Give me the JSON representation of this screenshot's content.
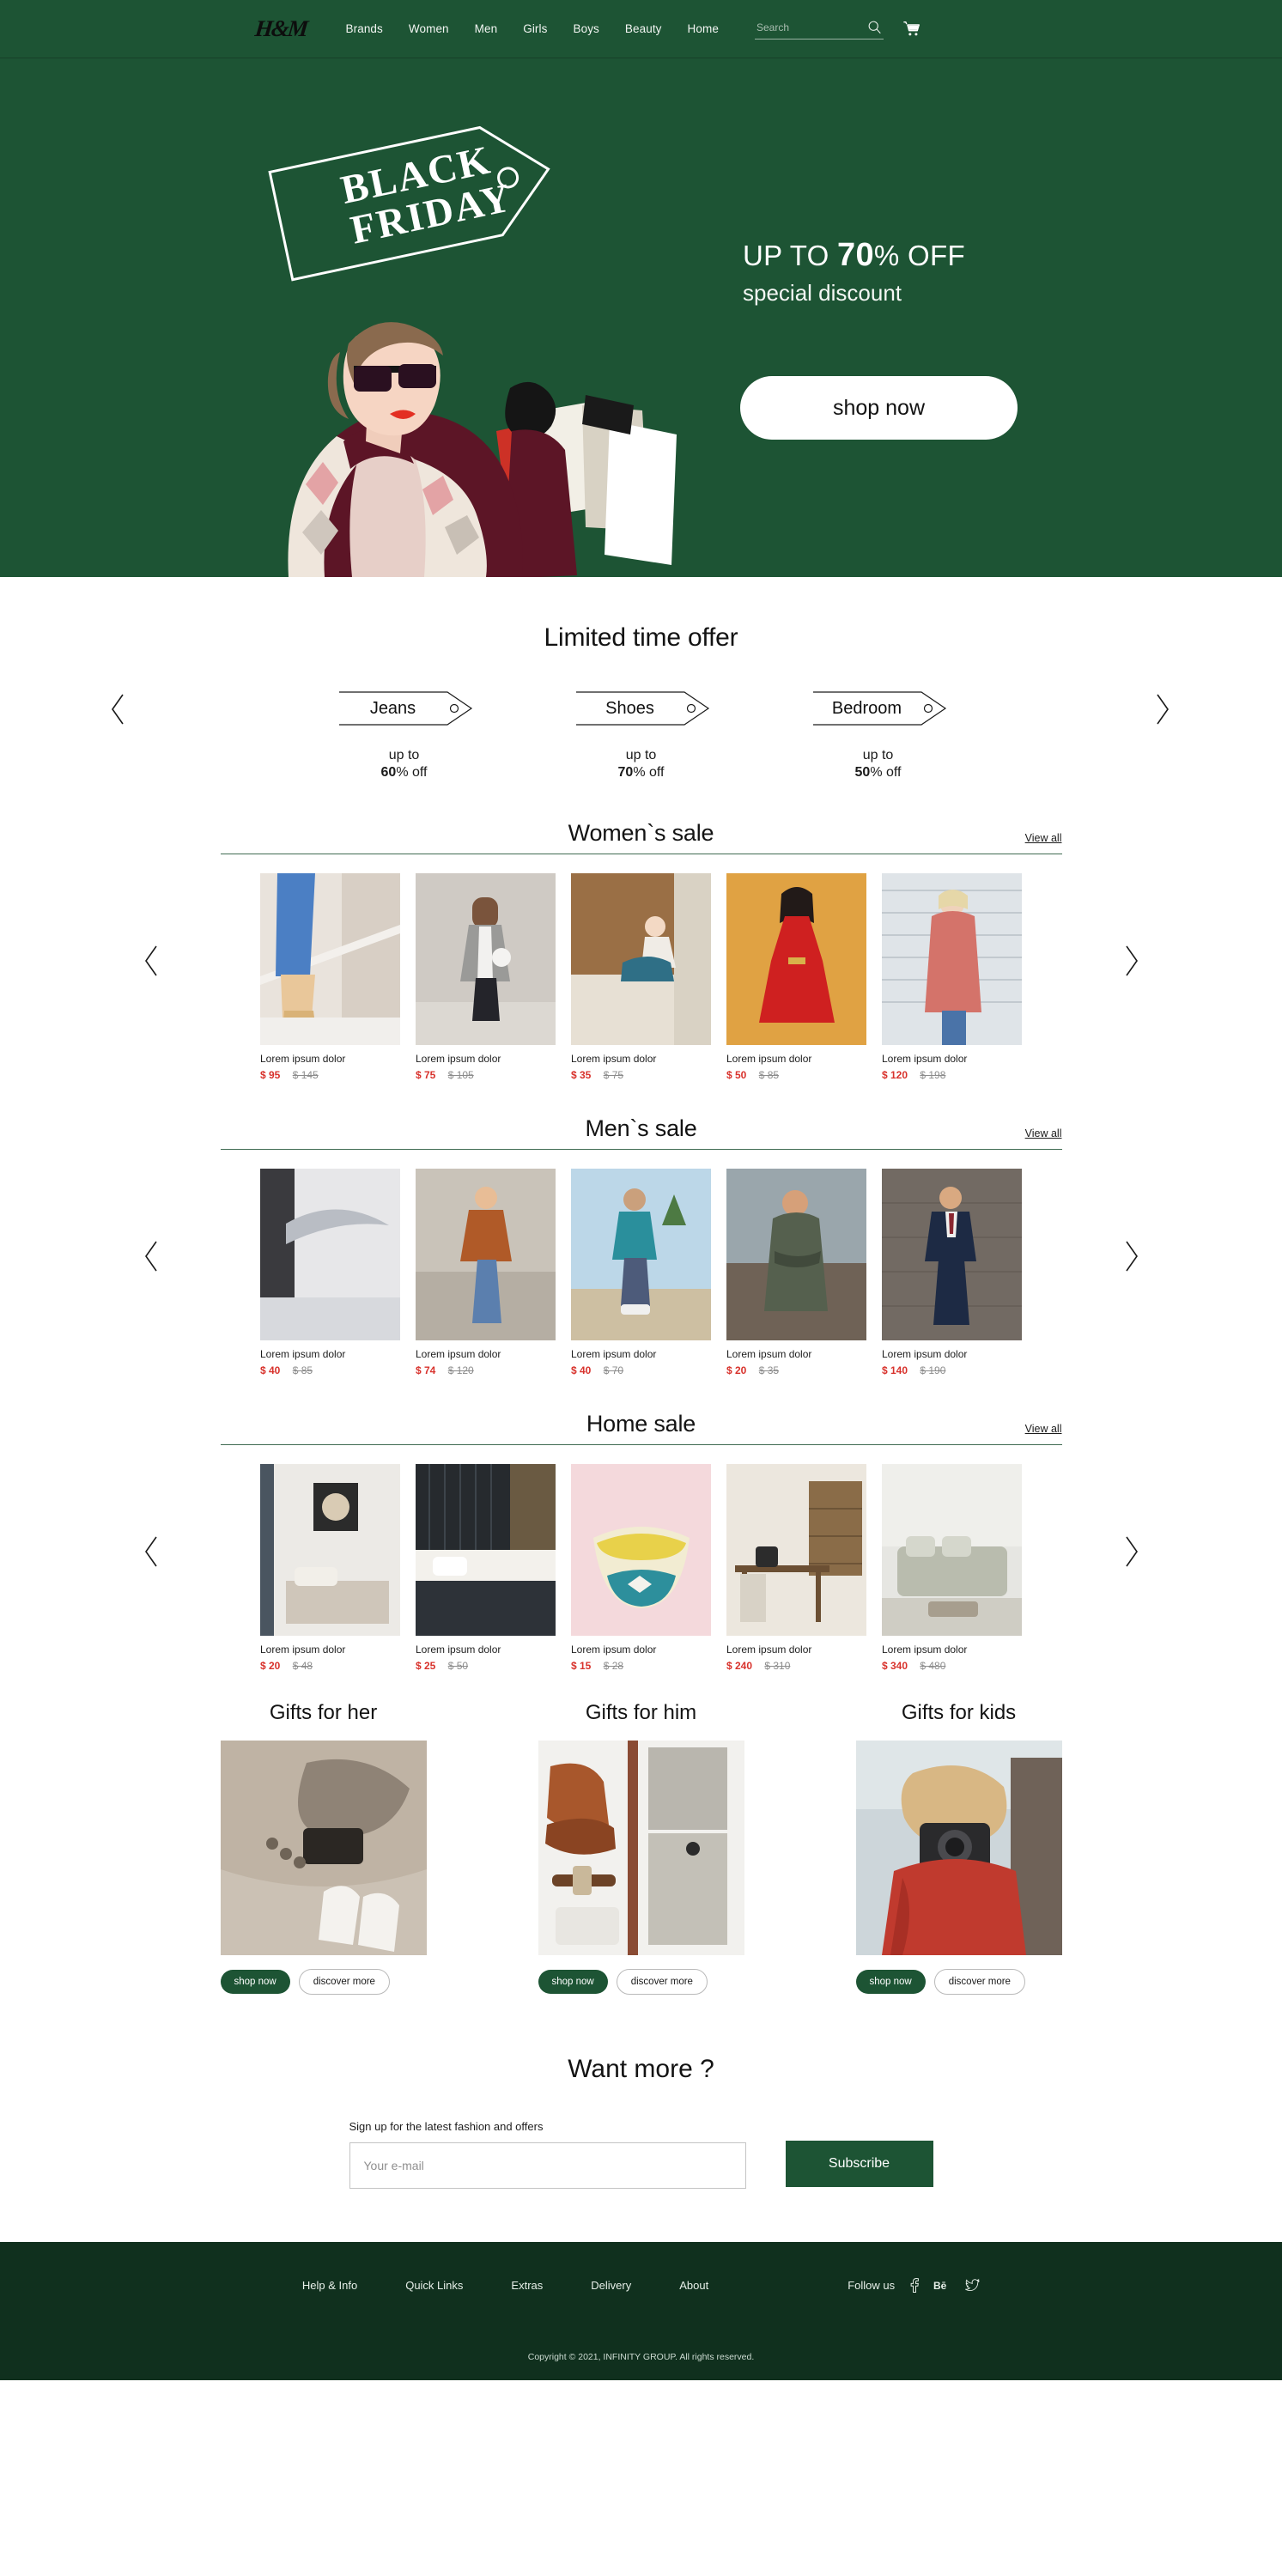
{
  "brand": {
    "logo_text": "H&M",
    "accent_green": "#1d5434",
    "footer_green": "#10301e",
    "sale_red": "#d8322c"
  },
  "header": {
    "nav": [
      {
        "label": "Brands"
      },
      {
        "label": "Women"
      },
      {
        "label": "Men"
      },
      {
        "label": "Girls"
      },
      {
        "label": "Boys"
      },
      {
        "label": "Beauty"
      },
      {
        "label": "Home"
      }
    ],
    "search": {
      "placeholder": "Search",
      "value": ""
    },
    "search_icon": "search-icon",
    "cart_icon": "shopping-cart-icon"
  },
  "hero": {
    "tag_line1": "BLACK",
    "tag_line2": "FRIDAY",
    "offer_prefix": "UP TO ",
    "offer_number": "70",
    "offer_suffix": "% OFF",
    "offer_sub": "special discount",
    "cta": "shop now"
  },
  "limited": {
    "title": "Limited time offer",
    "prev_label": "previous",
    "next_label": "next",
    "cards": [
      {
        "label": "Jeans",
        "upto": "up to",
        "pct": "60",
        "off": "% off"
      },
      {
        "label": "Shoes",
        "upto": "up to",
        "pct": "70",
        "off": "% off"
      },
      {
        "label": "Bedroom",
        "upto": "up to",
        "pct": "50",
        "off": "% off"
      }
    ]
  },
  "sections": [
    {
      "title": "Women`s sale",
      "view_all": "View all",
      "products": [
        {
          "name": "Lorem ipsum dolor",
          "sale": "$ 95",
          "orig": "$ 145"
        },
        {
          "name": "Lorem ipsum dolor",
          "sale": "$ 75",
          "orig": "$ 105"
        },
        {
          "name": "Lorem ipsum dolor",
          "sale": "$ 35",
          "orig": "$ 75"
        },
        {
          "name": "Lorem ipsum dolor",
          "sale": "$ 50",
          "orig": "$ 85"
        },
        {
          "name": "Lorem ipsum dolor",
          "sale": "$ 120",
          "orig": "$ 198"
        }
      ]
    },
    {
      "title": "Men`s sale",
      "view_all": "View all",
      "products": [
        {
          "name": "Lorem ipsum dolor",
          "sale": "$ 40",
          "orig": "$ 85"
        },
        {
          "name": "Lorem ipsum dolor",
          "sale": "$ 74",
          "orig": "$ 120"
        },
        {
          "name": "Lorem ipsum dolor",
          "sale": "$ 40",
          "orig": "$ 70"
        },
        {
          "name": "Lorem ipsum dolor",
          "sale": "$ 20",
          "orig": "$ 35"
        },
        {
          "name": "Lorem ipsum dolor",
          "sale": "$ 140",
          "orig": "$ 190"
        }
      ]
    },
    {
      "title": "Home sale",
      "view_all": "View all",
      "products": [
        {
          "name": "Lorem ipsum dolor",
          "sale": "$ 20",
          "orig": "$ 48"
        },
        {
          "name": "Lorem ipsum dolor",
          "sale": "$ 25",
          "orig": "$ 50"
        },
        {
          "name": "Lorem ipsum dolor",
          "sale": "$ 15",
          "orig": "$ 28"
        },
        {
          "name": "Lorem ipsum dolor",
          "sale": "$ 240",
          "orig": "$ 310"
        },
        {
          "name": "Lorem ipsum dolor",
          "sale": "$ 340",
          "orig": "$ 480"
        }
      ]
    }
  ],
  "gifts": [
    {
      "title": "Gifts for her",
      "shop": "shop now",
      "discover": "discover more"
    },
    {
      "title": "Gifts for him",
      "shop": "shop now",
      "discover": "discover more"
    },
    {
      "title": "Gifts for kids",
      "shop": "shop now",
      "discover": "discover more"
    }
  ],
  "newsletter": {
    "title": "Want more ?",
    "hint": "Sign up for the latest fashion and offers",
    "placeholder": "Your e-mail",
    "value": "",
    "button": "Subscribe"
  },
  "footer": {
    "links": [
      {
        "label": "Help & Info"
      },
      {
        "label": "Quick Links"
      },
      {
        "label": "Extras"
      },
      {
        "label": "Delivery"
      },
      {
        "label": "About"
      }
    ],
    "follow_label": "Follow us",
    "social": [
      {
        "name": "facebook-icon",
        "glyph": "f"
      },
      {
        "name": "behance-icon",
        "glyph": "Bē"
      },
      {
        "name": "twitter-icon",
        "glyph": "t"
      }
    ],
    "copyright": "Copyright © 2021, INFINITY GROUP. All rights reserved."
  }
}
